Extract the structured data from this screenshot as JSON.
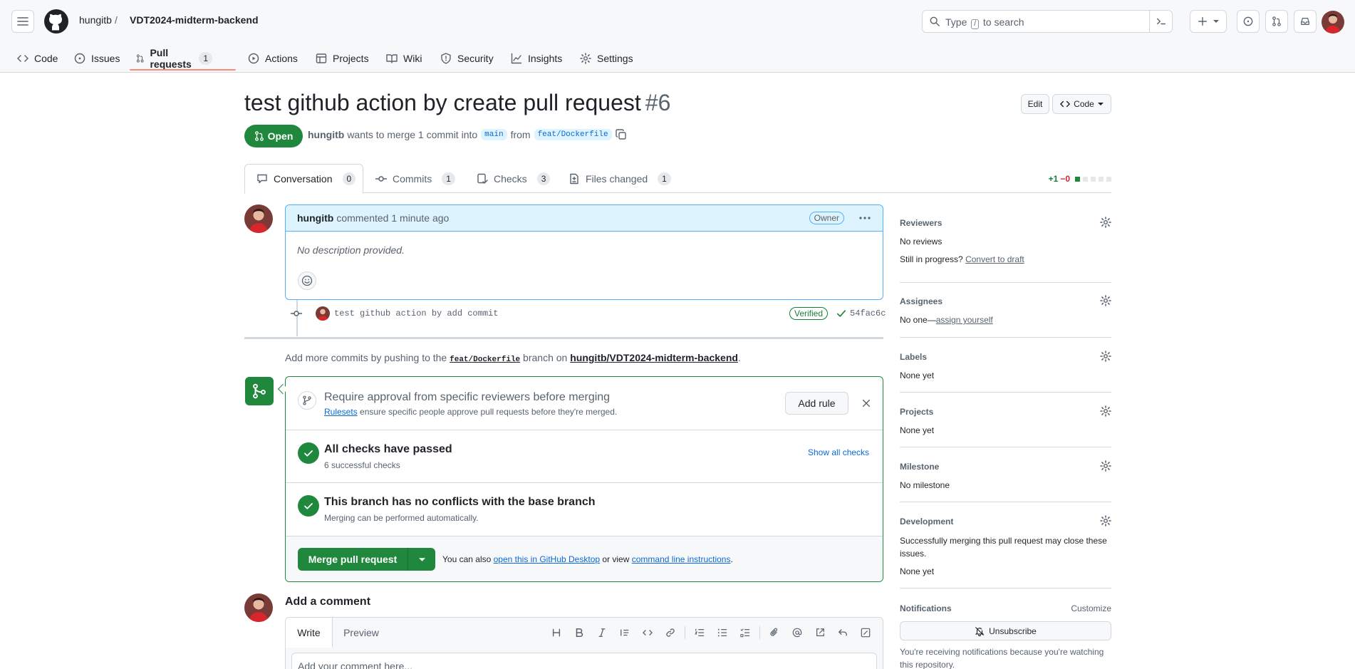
{
  "colors": {
    "accent": "#0969da",
    "success": "#1f883d",
    "tab_underline": "#fd8c73",
    "danger": "#d1242f"
  },
  "header": {
    "owner": "hungitb",
    "separator": "/",
    "repo": "VDT2024-midterm-backend",
    "search_prefix": "Type",
    "search_key": "/",
    "search_suffix": "to search"
  },
  "repo_tabs": [
    {
      "label": "Code",
      "icon": "code-icon"
    },
    {
      "label": "Issues",
      "icon": "issue-icon"
    },
    {
      "label": "Pull requests",
      "icon": "pull-request-icon",
      "count": "1",
      "active": true
    },
    {
      "label": "Actions",
      "icon": "play-icon"
    },
    {
      "label": "Projects",
      "icon": "table-icon"
    },
    {
      "label": "Wiki",
      "icon": "book-icon"
    },
    {
      "label": "Security",
      "icon": "shield-icon"
    },
    {
      "label": "Insights",
      "icon": "graph-icon"
    },
    {
      "label": "Settings",
      "icon": "gear-icon"
    }
  ],
  "pr": {
    "title": "test github action by create pull request",
    "number": "#6",
    "edit_label": "Edit",
    "code_label": "Code",
    "state": "Open",
    "author": "hungitb",
    "meta_text": "wants to merge 1 commit into",
    "base_branch": "main",
    "from_text": "from",
    "head_branch": "feat/Dockerfile"
  },
  "pr_tabs": [
    {
      "label": "Conversation",
      "count": "0"
    },
    {
      "label": "Commits",
      "count": "1"
    },
    {
      "label": "Checks",
      "count": "3"
    },
    {
      "label": "Files changed",
      "count": "1"
    }
  ],
  "diffstat": {
    "additions": "+1",
    "deletions": "−0"
  },
  "comment": {
    "author": "hungitb",
    "action": "commented",
    "time": "1 minute ago",
    "role": "Owner",
    "body": "No description provided."
  },
  "commit": {
    "message": "test github action by add commit",
    "verified": "Verified",
    "sha": "54fac6c"
  },
  "push_note": {
    "prefix": "Add more commits by pushing to the",
    "branch": "feat/Dockerfile",
    "middle": "branch on",
    "repo": "hungitb/VDT2024-midterm-backend",
    "suffix": "."
  },
  "merge": {
    "rule_title": "Require approval from specific reviewers before merging",
    "rule_link": "Rulesets",
    "rule_sub": "ensure specific people approve pull requests before they're merged.",
    "add_rule": "Add rule",
    "checks_title": "All checks have passed",
    "checks_sub": "6 successful checks",
    "show_checks": "Show all checks",
    "conflict_title": "This branch has no conflicts with the base branch",
    "conflict_sub": "Merging can be performed automatically.",
    "merge_button": "Merge pull request",
    "also_prefix": "You can also",
    "desktop_link": "open this in GitHub Desktop",
    "also_middle": "or view",
    "cli_link": "command line instructions",
    "also_suffix": "."
  },
  "add_comment": {
    "heading": "Add a comment",
    "write_tab": "Write",
    "preview_tab": "Preview",
    "placeholder": "Add your comment here...",
    "tools": [
      "heading-icon",
      "bold-icon",
      "italic-icon",
      "quote-icon",
      "code-icon",
      "link-icon",
      "ordered-list-icon",
      "unordered-list-icon",
      "task-list-icon",
      "attach-icon",
      "mention-icon",
      "cross-reference-icon",
      "reply-icon",
      "fullscreen-icon"
    ]
  },
  "sidebar": {
    "reviewers": {
      "heading": "Reviewers",
      "value": "No reviews",
      "draft_prefix": "Still in progress?",
      "draft_link": "Convert to draft"
    },
    "assignees": {
      "heading": "Assignees",
      "value": "No one—",
      "link": "assign yourself"
    },
    "labels": {
      "heading": "Labels",
      "value": "None yet"
    },
    "projects": {
      "heading": "Projects",
      "value": "None yet"
    },
    "milestone": {
      "heading": "Milestone",
      "value": "No milestone"
    },
    "development": {
      "heading": "Development",
      "note": "Successfully merging this pull request may close these issues.",
      "value": "None yet"
    },
    "notifications": {
      "heading": "Notifications",
      "customize": "Customize",
      "unsubscribe": "Unsubscribe",
      "note": "You're receiving notifications because you're watching this repository."
    }
  }
}
